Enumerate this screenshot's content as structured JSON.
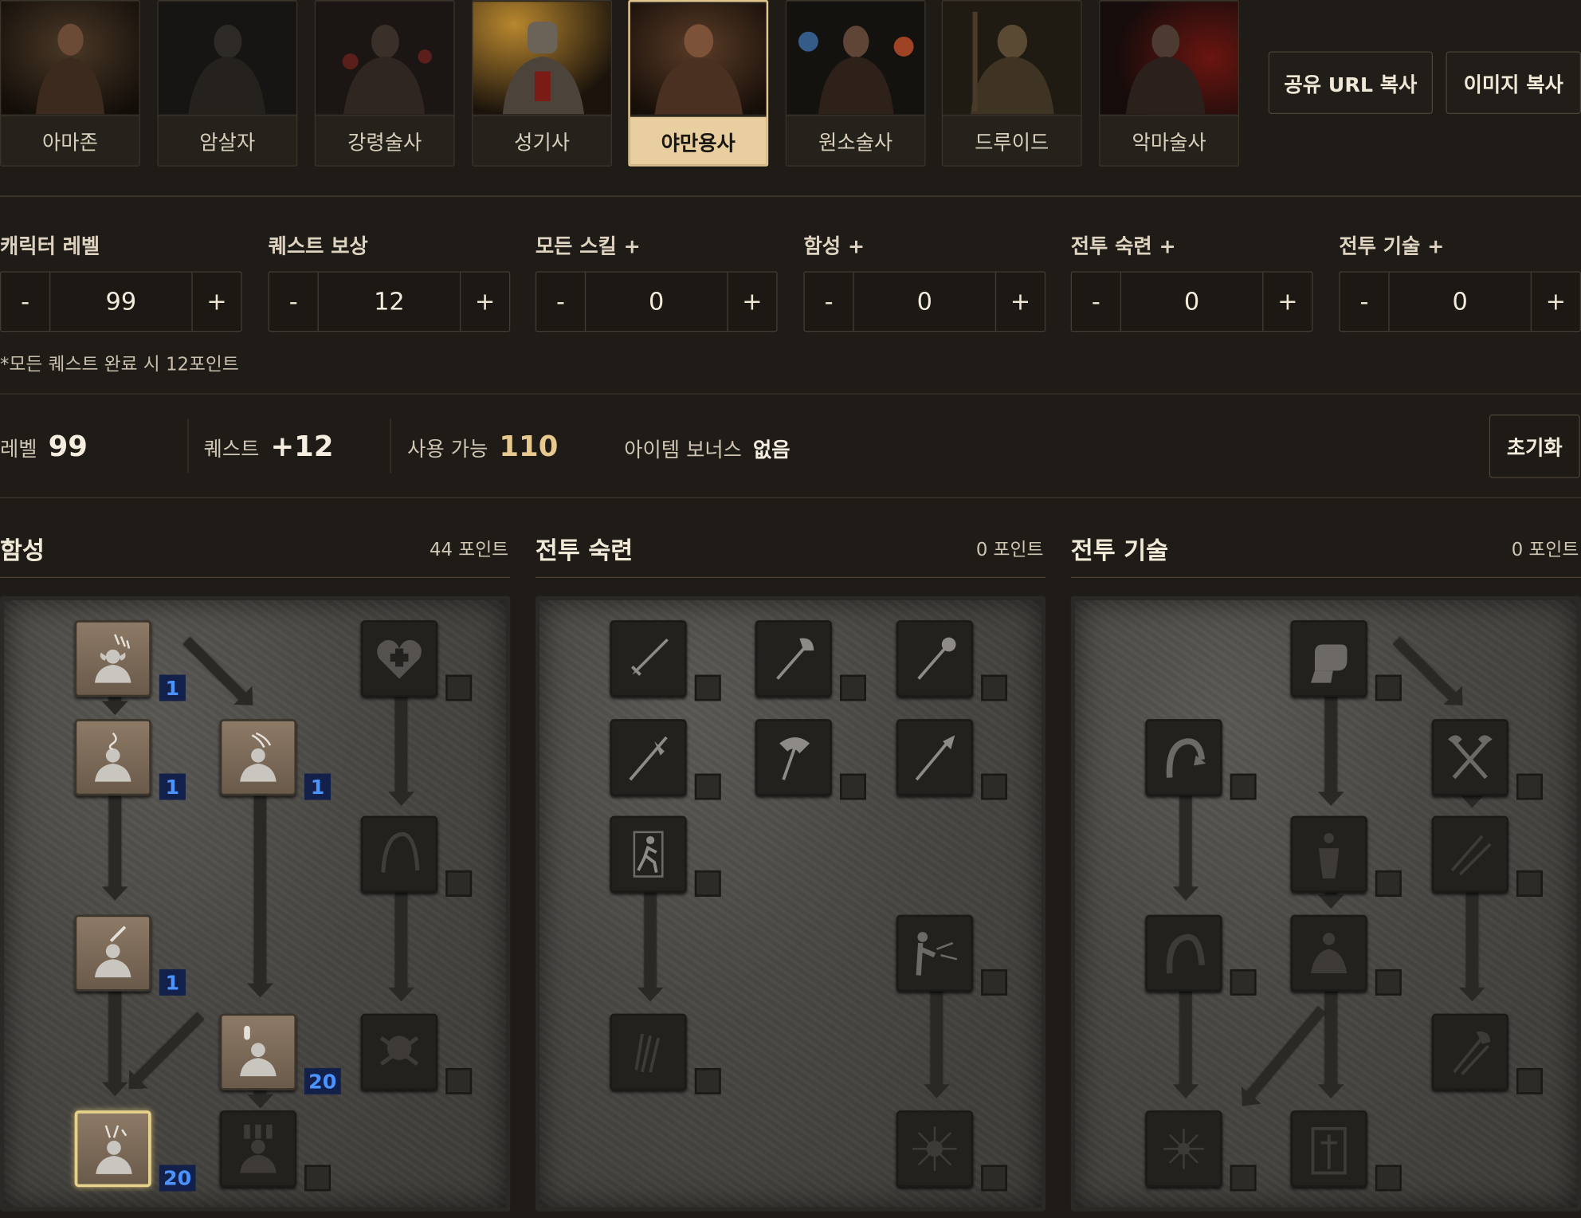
{
  "classes": [
    {
      "name": "아마존"
    },
    {
      "name": "암살자"
    },
    {
      "name": "강령술사"
    },
    {
      "name": "성기사"
    },
    {
      "name": "야만용사"
    },
    {
      "name": "원소술사"
    },
    {
      "name": "드루이드"
    },
    {
      "name": "악마술사"
    }
  ],
  "selected_class": "야만용사",
  "buttons": {
    "share_url": "공유 URL 복사",
    "copy_image": "이미지 복사",
    "reset": "초기화"
  },
  "controls": [
    {
      "label": "캐릭터 레벨",
      "value": "99"
    },
    {
      "label": "퀘스트 보상",
      "value": "12"
    },
    {
      "label": "모든 스킬 +",
      "value": "0"
    },
    {
      "label": "함성 +",
      "value": "0"
    },
    {
      "label": "전투 숙련 +",
      "value": "0"
    },
    {
      "label": "전투 기술 +",
      "value": "0"
    }
  ],
  "stepper": {
    "minus": "-",
    "plus": "+"
  },
  "quest_note": "*모든 퀘스트 완료 시 12포인트",
  "summary": {
    "level_label": "레벨",
    "level_value": "99",
    "quest_label": "퀘스트",
    "quest_value": "+12",
    "available_label": "사용 가능",
    "available_value": "110",
    "item_bonus_label": "아이템 보너스",
    "item_bonus_value": "없음"
  },
  "trees": [
    {
      "title": "함성",
      "points": "44 포인트"
    },
    {
      "title": "전투 숙련",
      "points": "0 포인트"
    },
    {
      "title": "전투 기술",
      "points": "0 포인트"
    }
  ],
  "skill_levels": {
    "howl": "1",
    "find_potion": "1",
    "taunt": "1",
    "find_item": "1",
    "battle_cry": "20",
    "battle_orders": "20"
  },
  "colors": {
    "accent": "#e9cf9f",
    "available": "#e7c98f",
    "level_badge": "#4b93ff"
  }
}
